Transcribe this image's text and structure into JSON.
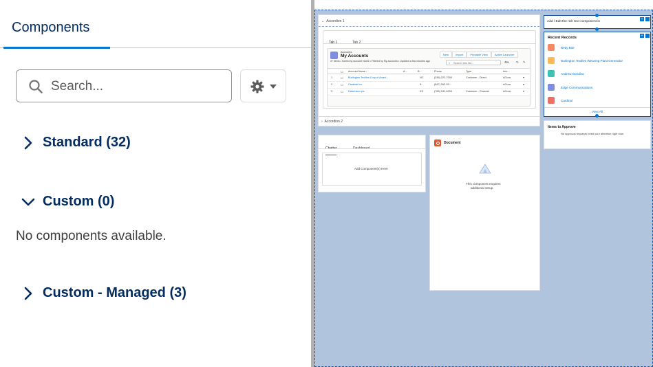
{
  "panel": {
    "tab_label": "Components",
    "search": {
      "placeholder": "Search..."
    },
    "sections": [
      {
        "label": "Standard (32)",
        "expanded": false
      },
      {
        "label": "Custom (0)",
        "expanded": true
      },
      {
        "label": "Custom - Managed (3)",
        "expanded": false
      }
    ],
    "empty_message": "No components available."
  },
  "canvas": {
    "accordion": {
      "section1": "Accordion 1",
      "section2": "Accordion 2",
      "tabs": [
        "Tab 1",
        "Tab 2"
      ]
    },
    "list_view": {
      "object": "Accounts",
      "title": "My Accounts",
      "meta": "3+ items • Sorted by Account Name • Filtered by My accounts • Updated a few minutes ago",
      "buttons": [
        "New",
        "Import",
        "Printable View",
        "Active Launcher"
      ],
      "search_placeholder": "Search this list...",
      "columns": [
        "Account Name ↑",
        "A...",
        "B...",
        "Phone",
        "Type",
        "Acc..."
      ],
      "rows": [
        {
          "num": "1",
          "name": "Burlington Textiles Corp of Ameri...",
          "state": "NC",
          "phone": "(336) 222-7000",
          "type": "Customer - Direct",
          "owner": "AGora"
        },
        {
          "num": "2",
          "name": "Cardinal Inc.",
          "state": "IL",
          "phone": "(847) 262-53...",
          "type": "",
          "owner": "AGora"
        },
        {
          "num": "3",
          "name": "Dickenson plc",
          "state": "KS",
          "phone": "(785) 241-6200",
          "type": "Customer - Channel",
          "owner": "AGora"
        }
      ]
    },
    "rich_text": "Add / Edit the rich text component in",
    "recent_records": {
      "title": "Recent Records",
      "items": [
        {
          "label": "Betty Bair",
          "color": "#f88962"
        },
        {
          "label": "Burlington Textiles Weaving Plant Generator",
          "color": "#fcb95b"
        },
        {
          "label": "Andrew Dondino",
          "color": "#3cc2b3"
        },
        {
          "label": "Edge Communications",
          "color": "#7f8de1"
        },
        {
          "label": "Cardinal",
          "color": "#ef6e64"
        }
      ],
      "view_all": "View All"
    },
    "approvals": {
      "title": "Items to Approve",
      "message": "No approval requests need your attention right now."
    },
    "chatter": {
      "tabs": [
        "Chatter",
        "Dashboard"
      ],
      "drop_label": "Add Component(s) Here"
    },
    "document": {
      "title": "Document",
      "message_line1": "This component requires",
      "message_line2": "additional setup."
    }
  },
  "colors": {
    "accent": "#0176d3",
    "heading": "#032d60",
    "canvas_bg": "#b0c4de",
    "account_icon": "#7f8de1",
    "document_icon": "#e4572e"
  }
}
